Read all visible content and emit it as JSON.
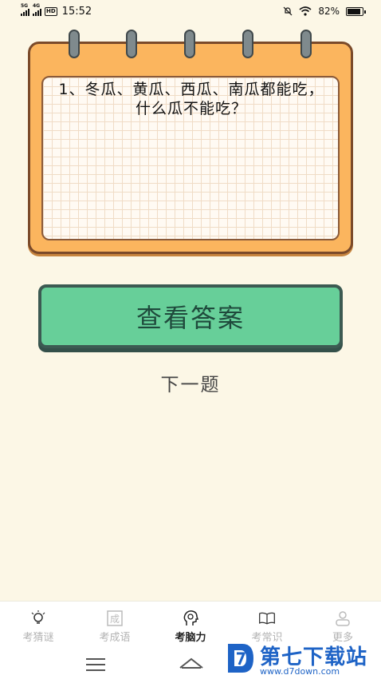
{
  "status_bar": {
    "network1": "5G",
    "network2": "4G",
    "hd_badge": "HD",
    "time": "15:52",
    "battery": "82%",
    "battery_level": 0.82
  },
  "question": {
    "text": "1、冬瓜、黄瓜、西瓜、南瓜都能吃，什么瓜不能吃？"
  },
  "buttons": {
    "show_answer": "查看答案",
    "next": "下一题"
  },
  "tabs": [
    {
      "label": "考猜谜",
      "icon": "lightbulb-icon",
      "active": false
    },
    {
      "label": "考成语",
      "icon": "idiom-card-icon",
      "active": false
    },
    {
      "label": "考脑力",
      "icon": "brain-head-icon",
      "active": true
    },
    {
      "label": "考常识",
      "icon": "book-icon",
      "active": false
    },
    {
      "label": "更多",
      "icon": "person-icon",
      "active": false
    }
  ],
  "idiom_icon_char": "成",
  "watermark": {
    "title": "第七下载站",
    "url": "www.d7down.com"
  },
  "colors": {
    "background": "#fcf7e6",
    "card": "#fbb55e",
    "button": "#67cf99",
    "watermark": "#1e63c6"
  }
}
